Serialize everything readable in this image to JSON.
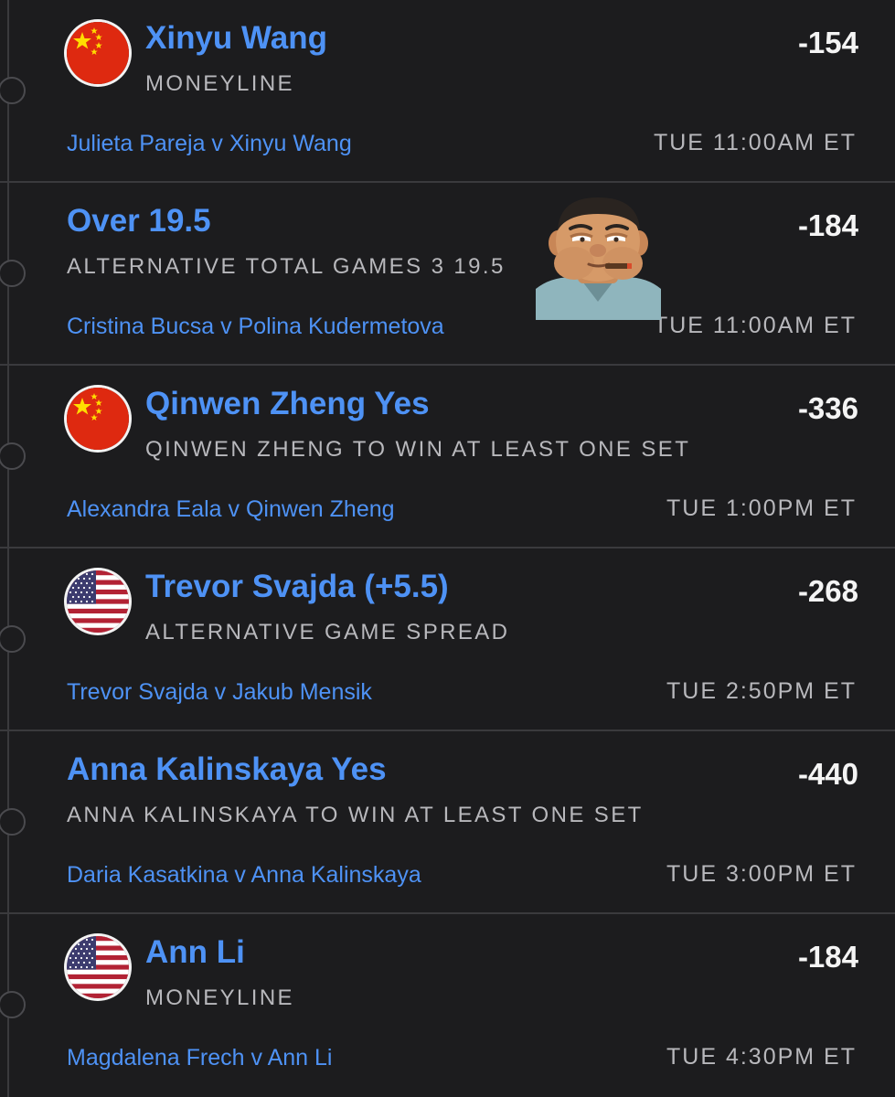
{
  "colors": {
    "background": "#1c1c1e",
    "selection_blue": "#4e92f5",
    "muted_text": "#b8b8bc",
    "odds_text": "#f4f4f4",
    "divider": "#3a3a3d"
  },
  "legs": [
    {
      "flag": "china-flag-icon",
      "selection": "Xinyu Wang",
      "market": "MONEYLINE",
      "odds": "-154",
      "matchup": "Julieta Pareja v Xinyu Wang",
      "time": "TUE 11:00AM ET"
    },
    {
      "flag": null,
      "selection": "Over 19.5",
      "market": "ALTERNATIVE TOTAL GAMES 3 19.5",
      "odds": "-184",
      "matchup": "Cristina Bucsa v Polina Kudermetova",
      "time": "TUE 11:00AM ET"
    },
    {
      "flag": "china-flag-icon",
      "selection": "Qinwen Zheng Yes",
      "market": "QINWEN ZHENG TO WIN AT LEAST ONE SET",
      "odds": "-336",
      "matchup": "Alexandra Eala v Qinwen Zheng",
      "time": "TUE 1:00PM ET"
    },
    {
      "flag": "usa-flag-icon",
      "selection": "Trevor Svajda (+5.5)",
      "market": "ALTERNATIVE GAME SPREAD",
      "odds": "-268",
      "matchup": "Trevor Svajda v Jakub Mensik",
      "time": "TUE 2:50PM ET"
    },
    {
      "flag": null,
      "selection": "Anna Kalinskaya Yes",
      "market": "ANNA KALINSKAYA TO WIN AT LEAST ONE SET",
      "odds": "-440",
      "matchup": "Daria Kasatkina v Anna Kalinskaya",
      "time": "TUE 3:00PM ET"
    },
    {
      "flag": "usa-flag-icon",
      "selection": "Ann Li",
      "market": "MONEYLINE",
      "odds": "-184",
      "matchup": "Magdalena Frech v Ann Li",
      "time": "TUE 4:30PM ET"
    }
  ],
  "sticker": "cartoon-man-with-cigar-sticker"
}
